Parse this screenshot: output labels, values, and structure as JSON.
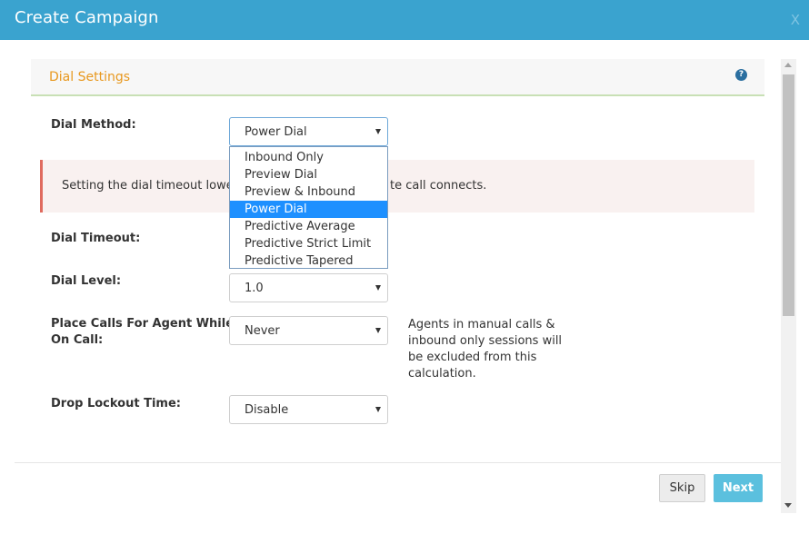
{
  "header": {
    "title": "Create Campaign",
    "close_label": "X"
  },
  "section": {
    "title": "Dial Settings",
    "help_label": "?"
  },
  "fields": {
    "dial_method": {
      "label": "Dial Method:",
      "value": "Power Dial"
    },
    "dial_timeout": {
      "label": "Dial Timeout:"
    },
    "dial_level": {
      "label": "Dial Level:",
      "value": "1.0"
    },
    "place_calls": {
      "label_line1": "Place Calls For Agent While",
      "label_line2": "On Call:",
      "value": "Never"
    },
    "drop_lockout": {
      "label": "Drop Lockout Time:",
      "value": "Disable"
    }
  },
  "alert": {
    "text_left": "Setting the dial timeout lower t",
    "text_right": "te call connects."
  },
  "dropdown": {
    "options": [
      "Inbound Only",
      "Preview Dial",
      "Preview & Inbound",
      "Power Dial",
      "Predictive Average",
      "Predictive Strict Limit",
      "Predictive Tapered"
    ],
    "selected": "Power Dial"
  },
  "note": {
    "line1": "Agents in manual calls &",
    "line2": "inbound only sessions will",
    "line3": "be excluded from this",
    "line4": "calculation."
  },
  "footer": {
    "skip_label": "Skip",
    "next_label": "Next"
  },
  "colors": {
    "header": "#3aa3cf",
    "section_title": "#e8981e",
    "selected_option": "#1e90ff",
    "next_button": "#5bc0de",
    "alert_border": "#e06b5f"
  }
}
